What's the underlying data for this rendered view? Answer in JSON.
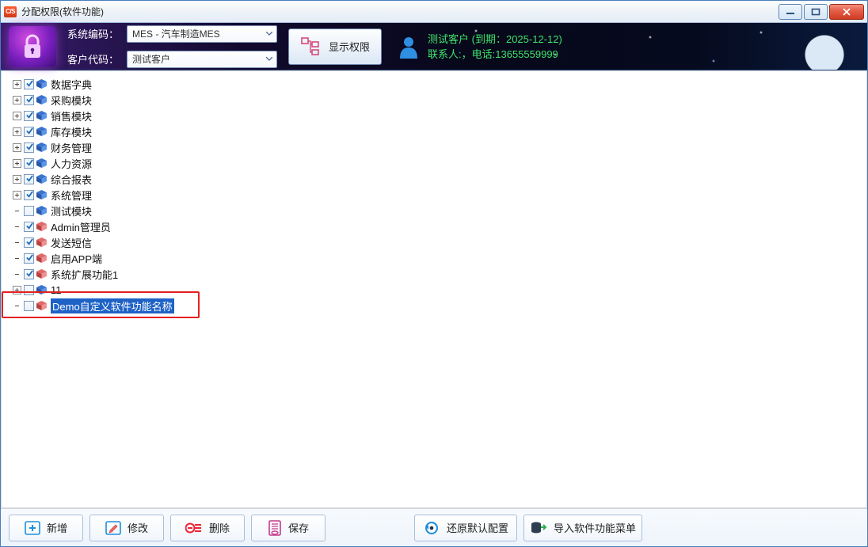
{
  "window": {
    "title": "分配权限(软件功能)"
  },
  "header": {
    "sys_label": "系统编码：",
    "cust_label": "客户代码：",
    "sys_value": "MES - 汽车制造MES",
    "cust_value": "测试客户",
    "show_perm_btn": "显示权限",
    "info_line1": "测试客户 (到期：2025-12-12)",
    "info_line2": "联系人:，电话:13655559999"
  },
  "tree": {
    "items": [
      {
        "label": "数据字典",
        "checked": true,
        "exp": "plus",
        "blue": true
      },
      {
        "label": "采购模块",
        "checked": true,
        "exp": "plus",
        "blue": true
      },
      {
        "label": "销售模块",
        "checked": true,
        "exp": "plus",
        "blue": true
      },
      {
        "label": "库存模块",
        "checked": true,
        "exp": "plus",
        "blue": true
      },
      {
        "label": "财务管理",
        "checked": true,
        "exp": "plus",
        "blue": true
      },
      {
        "label": "人力资源",
        "checked": true,
        "exp": "plus",
        "blue": true
      },
      {
        "label": "综合报表",
        "checked": true,
        "exp": "plus",
        "blue": true
      },
      {
        "label": "系统管理",
        "checked": true,
        "exp": "plus",
        "blue": true
      },
      {
        "label": "测试模块",
        "checked": false,
        "exp": "none",
        "blue": true
      },
      {
        "label": "Admin管理员",
        "checked": true,
        "exp": "none",
        "blue": false
      },
      {
        "label": "发送短信",
        "checked": true,
        "exp": "none",
        "blue": false
      },
      {
        "label": "启用APP端",
        "checked": true,
        "exp": "none",
        "blue": false
      },
      {
        "label": "系统扩展功能1",
        "checked": true,
        "exp": "none",
        "blue": false
      },
      {
        "label": "11",
        "checked": false,
        "exp": "plus",
        "blue": true
      },
      {
        "label": "Demo自定义软件功能名称",
        "checked": false,
        "exp": "none",
        "blue": false,
        "selected": true,
        "highlight": true
      }
    ]
  },
  "footer": {
    "add": "新增",
    "edit": "修改",
    "del": "删除",
    "save": "保存",
    "restore": "还原默认配置",
    "import": "导入软件功能菜单"
  }
}
